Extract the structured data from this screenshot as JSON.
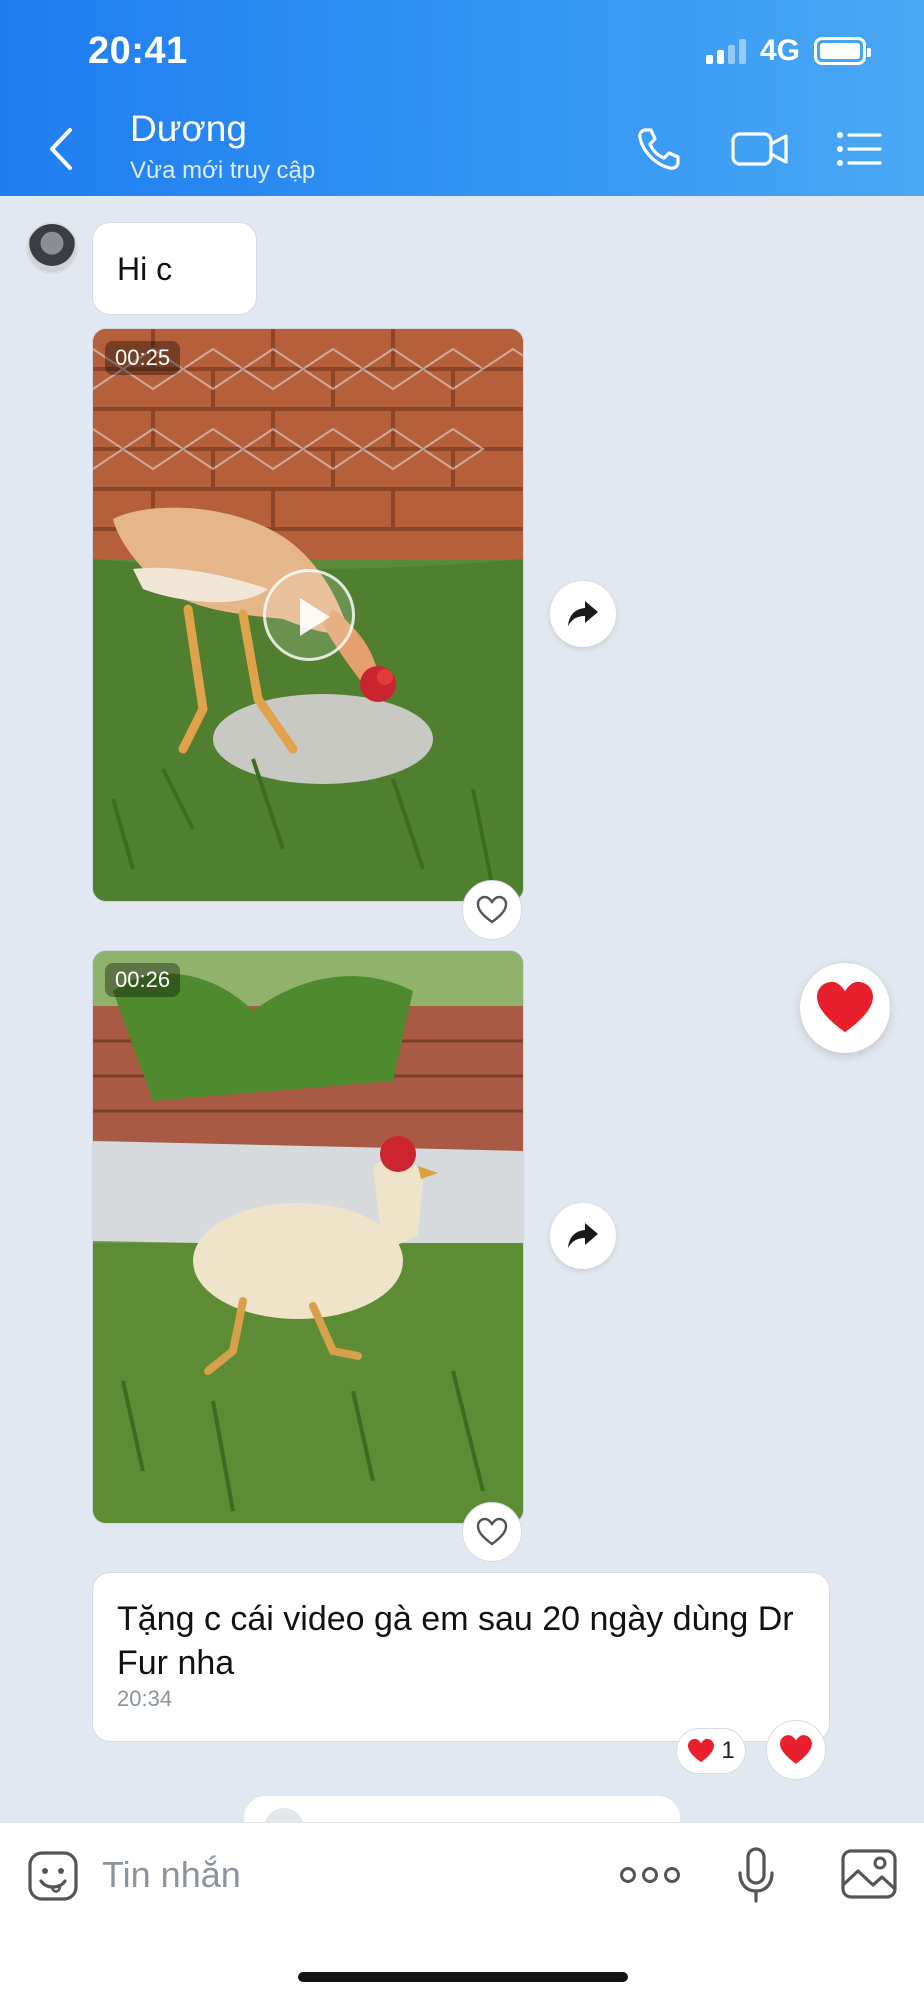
{
  "status_bar": {
    "time": "20:41",
    "network": "4G"
  },
  "header": {
    "contact_name": "Dương",
    "presence": "Vừa mới truy cập",
    "icons": [
      "back-icon",
      "phone-icon",
      "video-call-icon",
      "menu-list-icon"
    ]
  },
  "messages": [
    {
      "type": "text",
      "text": "Hi c"
    },
    {
      "type": "video",
      "duration": "00:25"
    },
    {
      "type": "video",
      "duration": "00:26"
    },
    {
      "type": "text",
      "text": "Tặng c cái video gà em sau 20 ngày dùng Dr Fur nha",
      "time": "20:34",
      "reaction_count": "1"
    }
  ],
  "composer": {
    "placeholder": "Tin nhắn"
  },
  "colors": {
    "header_blue": "#1f7df2",
    "background": "#e2e8f1",
    "heart_red": "#e8202e"
  }
}
